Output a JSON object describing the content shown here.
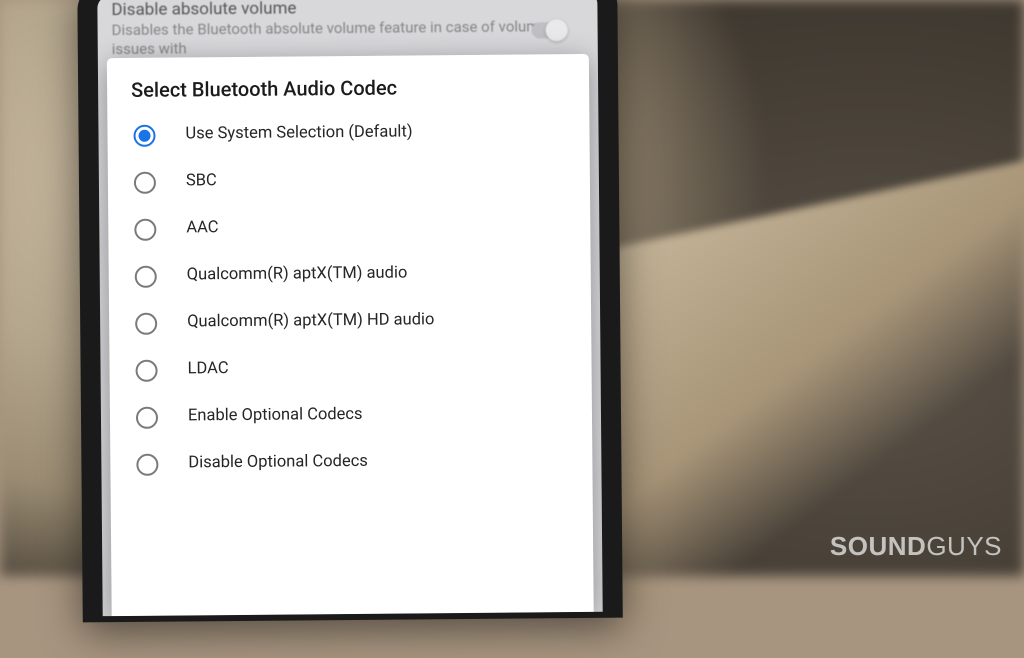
{
  "backgroundSetting": {
    "title": "Disable absolute volume",
    "description": "Disables the Bluetooth absolute volume feature in case of volume issues with"
  },
  "dialog": {
    "title": "Select Bluetooth Audio Codec",
    "options": [
      {
        "label": "Use System Selection (Default)",
        "selected": true
      },
      {
        "label": "SBC",
        "selected": false
      },
      {
        "label": "AAC",
        "selected": false
      },
      {
        "label": "Qualcomm(R) aptX(TM) audio",
        "selected": false
      },
      {
        "label": "Qualcomm(R) aptX(TM) HD audio",
        "selected": false
      },
      {
        "label": "LDAC",
        "selected": false
      },
      {
        "label": "Enable Optional Codecs",
        "selected": false
      },
      {
        "label": "Disable Optional Codecs",
        "selected": false
      }
    ]
  },
  "watermark": {
    "bold": "SOUND",
    "light": "GUYS"
  }
}
